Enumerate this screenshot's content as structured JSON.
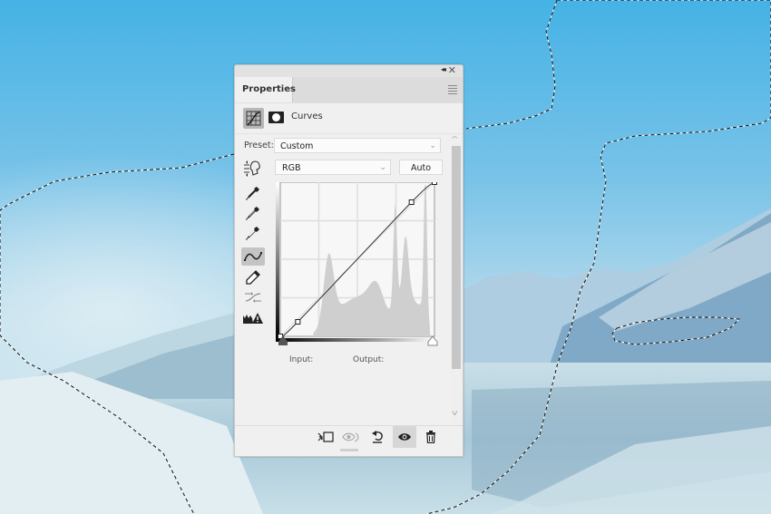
{
  "panel": {
    "tab_label": "Properties",
    "adjustment_name": "Curves",
    "preset_label": "Preset:",
    "preset_value": "Custom",
    "channel_value": "RGB",
    "auto_label": "Auto",
    "input_label": "Input:",
    "output_label": "Output:",
    "collapse_glyph": "◂◂",
    "close_glyph": "✕",
    "chevron_glyph": "⌄",
    "scroll_up_glyph": "^",
    "scroll_down_glyph": "v"
  },
  "tools": [
    {
      "name": "sample-black-point-eyedropper-icon",
      "active": false
    },
    {
      "name": "sample-gray-point-eyedropper-icon",
      "active": false
    },
    {
      "name": "sample-white-point-eyedropper-icon",
      "active": false
    },
    {
      "name": "edit-points-curve-icon",
      "active": true
    },
    {
      "name": "draw-pencil-icon",
      "active": false
    },
    {
      "name": "smooth-curve-icon",
      "active": false
    },
    {
      "name": "clipping-warning-icon",
      "active": false
    }
  ],
  "footer_buttons": [
    {
      "name": "clip-to-layer-button",
      "icon": "clip-icon",
      "active": false
    },
    {
      "name": "view-previous-state-button",
      "icon": "eye-swap-icon",
      "active": false
    },
    {
      "name": "reset-button",
      "icon": "reset-icon",
      "active": false
    },
    {
      "name": "toggle-visibility-button",
      "icon": "eye-icon",
      "active": true
    },
    {
      "name": "delete-button",
      "icon": "trash-icon",
      "active": false
    }
  ],
  "curve": {
    "channel": "RGB",
    "points": [
      [
        0,
        0
      ],
      [
        29,
        24
      ],
      [
        217,
        222
      ],
      [
        255,
        255
      ]
    ],
    "grid_divisions": 4,
    "histogram_peaks": "bimodal-high"
  },
  "colors": {
    "sky_top": "#4fb6e6",
    "sky_mid": "#8ccbe8",
    "snow": "#e6f0f4",
    "panel_bg": "#f0f0f0"
  }
}
